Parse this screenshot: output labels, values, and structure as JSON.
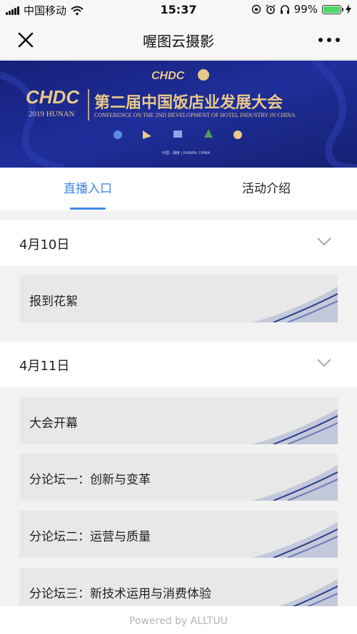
{
  "status_bar": {
    "carrier": "中国移动",
    "time": "15:37",
    "battery_text": "99%",
    "battery_level": 0.99
  },
  "nav": {
    "title": "喔图云摄影"
  },
  "banner": {
    "logo_text": "CHDC",
    "year_text": "2019 HUNAN",
    "title_cn": "第二届中国饭店业发展大会",
    "title_en": "CONFERENCE ON THE 2ND DEVELOPMENT OF HOTEL INDUSTRY IN CHINA",
    "location": "中国 · 湖南 | HUNAN, CHINA"
  },
  "tabs": [
    {
      "label": "直播入口",
      "active": true
    },
    {
      "label": "活动介绍",
      "active": false
    }
  ],
  "days": [
    {
      "date": "4月10日",
      "items": [
        "报到花絮"
      ]
    },
    {
      "date": "4月11日",
      "items": [
        "大会开幕",
        "分论坛一：创新与变革",
        "分论坛二：运营与质量",
        "分论坛三：新技术运用与消费体验"
      ]
    }
  ],
  "footer": {
    "text": "Powered by ALLTUU"
  },
  "colors": {
    "accent": "#3e86e8",
    "banner_bg": "#1c2a8f",
    "banner_gold": "#e9c987",
    "battery_green": "#4cd964"
  }
}
